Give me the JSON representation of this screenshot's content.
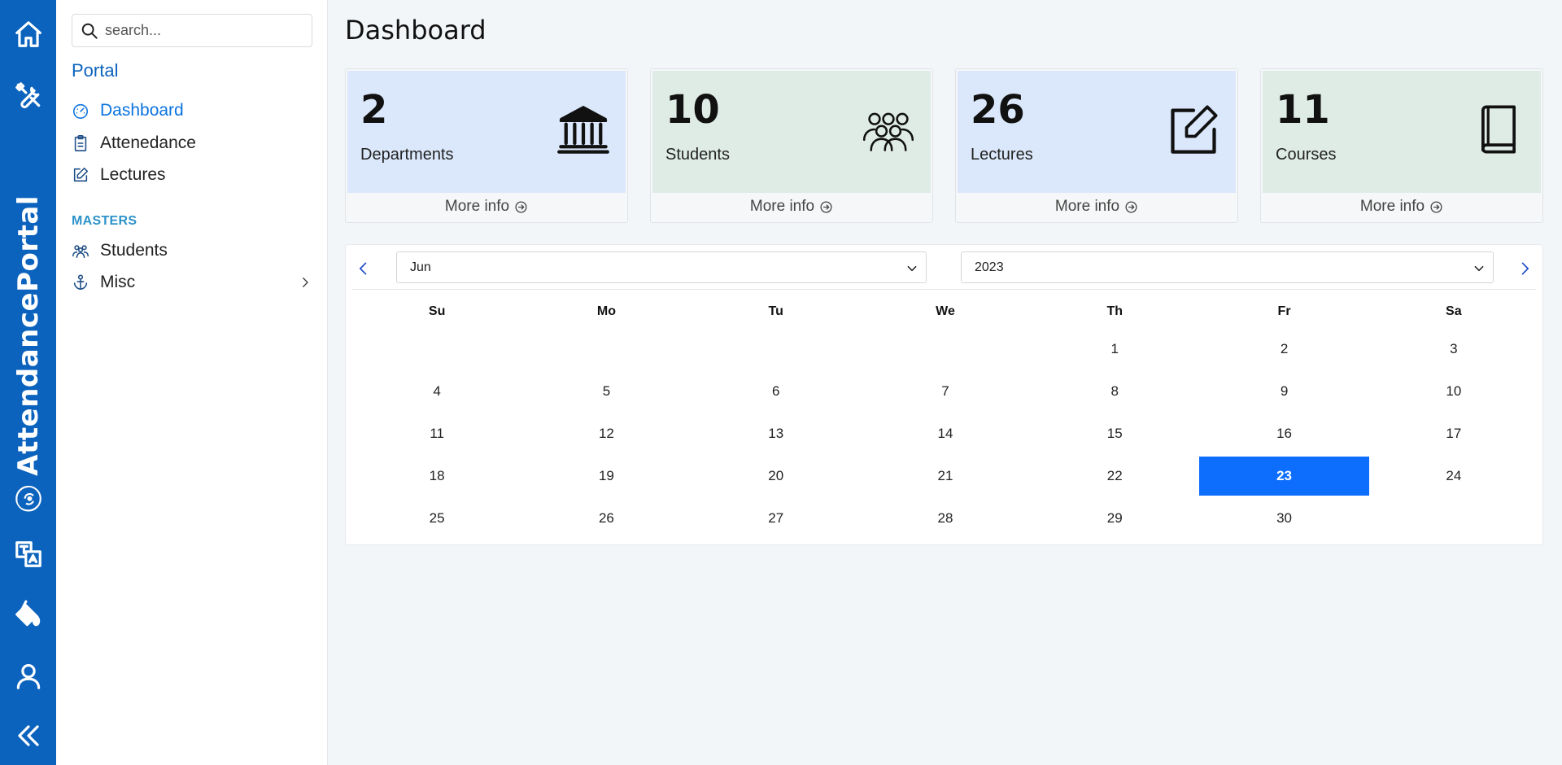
{
  "rail": {
    "brand": "AttendancePortal",
    "items": [
      "home-icon",
      "tools-icon",
      "translate-icon",
      "paint-bucket-icon",
      "user-icon",
      "collapse-icon"
    ]
  },
  "sidebar": {
    "search_placeholder": "search...",
    "portal_title": "Portal",
    "portal_items": [
      {
        "label": "Dashboard",
        "icon": "speedometer-icon",
        "active": true
      },
      {
        "label": "Attenedance",
        "icon": "clipboard-icon"
      },
      {
        "label": "Lectures",
        "icon": "pencil-square-icon"
      }
    ],
    "masters_title": "MASTERS",
    "masters_items": [
      {
        "label": "Students",
        "icon": "people-icon"
      },
      {
        "label": "Misc",
        "icon": "anchor-icon"
      }
    ]
  },
  "page": {
    "title": "Dashboard"
  },
  "cards": [
    {
      "value": "2",
      "label": "Departments",
      "more": "More info",
      "color": "#dbe8fb",
      "icon": "bank-icon"
    },
    {
      "value": "10",
      "label": "Students",
      "more": "More info",
      "color": "#dfece6",
      "icon": "people-icon"
    },
    {
      "value": "26",
      "label": "Lectures",
      "more": "More info",
      "color": "#dbe8fb",
      "icon": "pencil-square-icon"
    },
    {
      "value": "11",
      "label": "Courses",
      "more": "More info",
      "color": "#dfece6",
      "icon": "book-icon"
    }
  ],
  "calendar": {
    "month": "Jun",
    "year": "2023",
    "weekdays": [
      "Su",
      "Mo",
      "Tu",
      "We",
      "Th",
      "Fr",
      "Sa"
    ],
    "weeks": [
      [
        "",
        "",
        "",
        "",
        "1",
        "2",
        "3"
      ],
      [
        "4",
        "5",
        "6",
        "7",
        "8",
        "9",
        "10"
      ],
      [
        "11",
        "12",
        "13",
        "14",
        "15",
        "16",
        "17"
      ],
      [
        "18",
        "19",
        "20",
        "21",
        "22",
        "23",
        "24"
      ],
      [
        "25",
        "26",
        "27",
        "28",
        "29",
        "30",
        ""
      ]
    ],
    "selected": "23",
    "accent": "#0d6efd"
  },
  "colors": {
    "rail": "#0b63be",
    "active": "#0b73e0"
  }
}
